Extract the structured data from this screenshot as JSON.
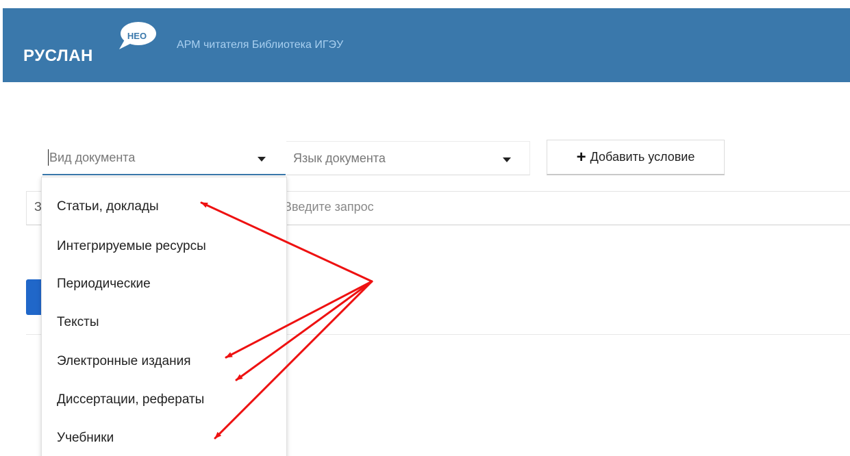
{
  "header": {
    "logo_text": "РУСЛАН",
    "logo_badge": "НЕО",
    "app_title": "АРМ читателя Библиотека ИГЭУ",
    "background_color": "#3a78ab"
  },
  "filters": {
    "doc_type": {
      "placeholder": "Вид документа",
      "icon": "caret-down-icon"
    },
    "language": {
      "placeholder": "Язык документа",
      "icon": "caret-down-icon"
    },
    "add_condition": {
      "icon": "plus-icon",
      "label": "Добавить условие"
    }
  },
  "query": {
    "prefix": "З",
    "placeholder": "Введите запрос"
  },
  "dropdown": {
    "items": [
      "Статьи, доклады",
      "Интегрируемые ресурсы",
      "Периодические",
      "Тексты",
      "Электронные издания",
      "Диссертации, рефераты",
      "Учебники"
    ]
  },
  "annotation": {
    "arrow_color": "#ee1111"
  }
}
